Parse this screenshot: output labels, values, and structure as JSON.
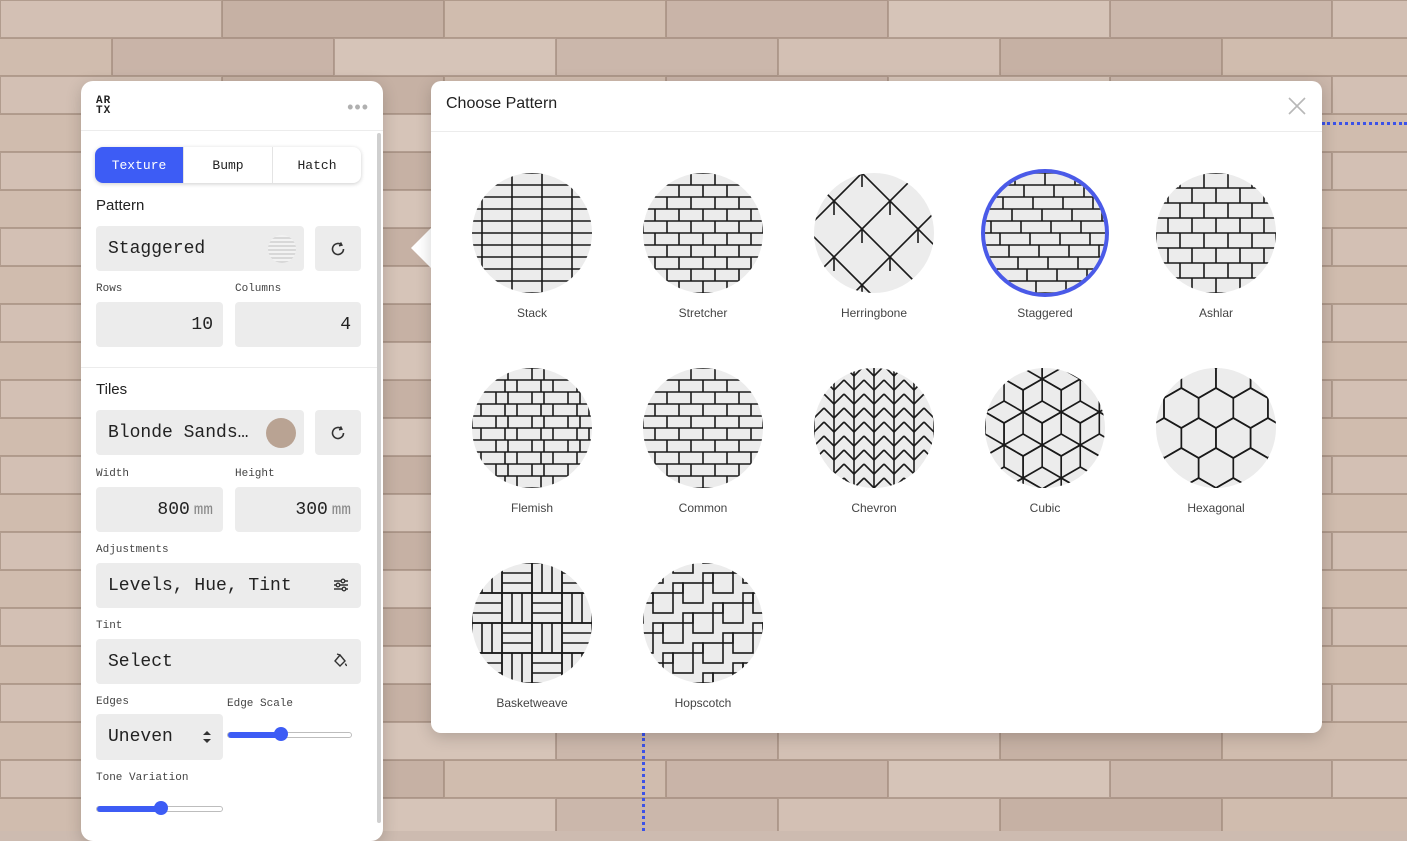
{
  "colors": {
    "accent": "#3d5cf5",
    "selection_ring": "#4a5ae8",
    "tile_swatch": "#b9a393"
  },
  "panel": {
    "logo": "ARTX",
    "menu_icon": "more-dots-icon",
    "tabs": [
      "Texture",
      "Bump",
      "Hatch"
    ],
    "active_tab": "Texture",
    "pattern": {
      "title": "Pattern",
      "value": "Staggered",
      "rows_label": "Rows",
      "rows": "10",
      "columns_label": "Columns",
      "columns": "4"
    },
    "tiles": {
      "title": "Tiles",
      "material": "Blonde Sands…",
      "width_label": "Width",
      "width": "800",
      "width_unit": "mm",
      "height_label": "Height",
      "height": "300",
      "height_unit": "mm",
      "adjustments_label": "Adjustments",
      "adjustments": "Levels, Hue, Tint",
      "tint_label": "Tint",
      "tint": "Select",
      "edges_label": "Edges",
      "edges": "Uneven",
      "edge_scale_label": "Edge Scale",
      "edge_scale": 0.42,
      "tone_variation_label": "Tone Variation",
      "tone_variation": 0.5
    }
  },
  "dialog": {
    "title": "Choose Pattern",
    "selected": "Staggered",
    "patterns": [
      {
        "name": "Stack"
      },
      {
        "name": "Stretcher"
      },
      {
        "name": "Herringbone"
      },
      {
        "name": "Staggered"
      },
      {
        "name": "Ashlar"
      },
      {
        "name": "Flemish"
      },
      {
        "name": "Common"
      },
      {
        "name": "Chevron"
      },
      {
        "name": "Cubic"
      },
      {
        "name": "Hexagonal"
      },
      {
        "name": "Basketweave"
      },
      {
        "name": "Hopscotch"
      }
    ]
  }
}
